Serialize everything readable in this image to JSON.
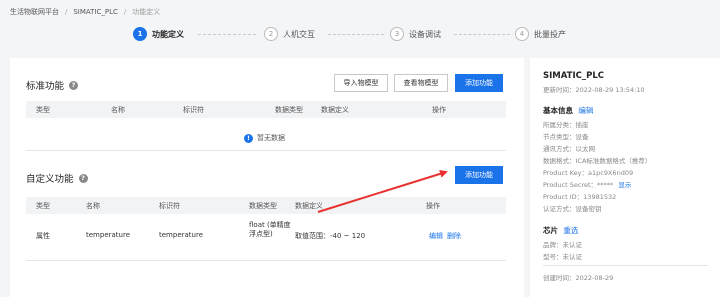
{
  "breadcrumb": [
    "生活物联网平台",
    "SIMATIC_PLC",
    "功能定义"
  ],
  "steps": [
    {
      "num": "1",
      "label": "功能定义"
    },
    {
      "num": "2",
      "label": "人机交互"
    },
    {
      "num": "3",
      "label": "设备调试"
    },
    {
      "num": "4",
      "label": "批量投产"
    }
  ],
  "standard": {
    "title": "标准功能",
    "help": "?",
    "buttons": {
      "import": "导入物模型",
      "view": "查看物模型",
      "add": "添加功能"
    },
    "columns": [
      "类型",
      "名称",
      "标识符",
      "数据类型",
      "数据定义",
      "操作"
    ],
    "empty": "暂无数据",
    "empty_icon": "!"
  },
  "custom": {
    "title": "自定义功能",
    "help": "?",
    "buttons": {
      "add": "添加功能"
    },
    "columns": [
      "类型",
      "名称",
      "标识符",
      "数据类型",
      "数据定义",
      "操作"
    ],
    "row": {
      "type": "属性",
      "name": "temperature",
      "identifier": "temperature",
      "data_type": "float (单精度浮点型)",
      "definition": "取值范围：-40 ~ 120",
      "edit": "编辑",
      "delete": "删除"
    }
  },
  "sidebar": {
    "product": "SIMATIC_PLC",
    "updated": "更新时间：2022-08-29 13:54:10",
    "basic_title": "基本信息",
    "basic_edit": "编辑",
    "category": "所属分类：插座",
    "node_type": "节点类型：设备",
    "network": "通讯方式：以太网",
    "data_format": "数据格式：ICA标准数据格式（推荐）",
    "product_key": "Product Key：a1pc9X6nd09",
    "product_secret": "Product Secret：*****",
    "secret_show": "显示",
    "product_id": "Product ID：13981532",
    "auth": "认证方式：设备密钥",
    "chip_title": "芯片",
    "chip_select": "重选",
    "brand": "品牌：未认证",
    "model": "型号：未认证",
    "created": "创建时间：2022-08-29"
  },
  "colors": {
    "primary": "#1a73e8",
    "arrow": "#e8322f"
  }
}
